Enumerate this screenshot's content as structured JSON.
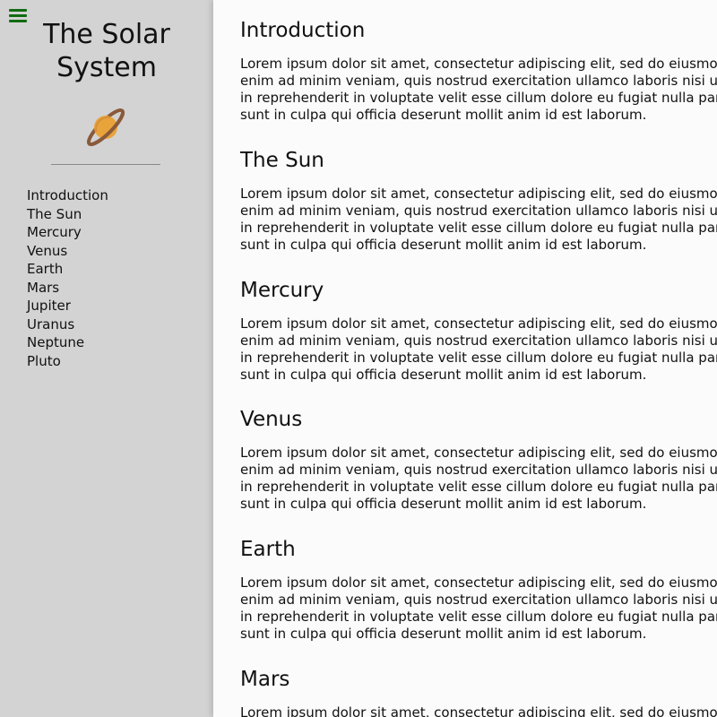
{
  "sidebar": {
    "title_line1": "The Solar",
    "title_line2": "System",
    "logo_icon": "planet-icon",
    "menu_icon": "hamburger-menu-icon",
    "nav_items": [
      "Introduction",
      "The Sun",
      "Mercury",
      "Venus",
      "Earth",
      "Mars",
      "Jupiter",
      "Uranus",
      "Neptune",
      "Pluto"
    ]
  },
  "colors": {
    "sidebar_bg": "#d3d3d3",
    "menu_icon": "#116b11",
    "planet_body": "#e8a33b",
    "planet_ring": "#8a5a3a"
  },
  "content": {
    "paragraph_lines": [
      "Lorem ipsum dolor sit amet, consectetur adipiscing elit, sed do eiusmod",
      "enim ad minim veniam, quis nostrud exercitation ullamco laboris nisi ut a",
      "in reprehenderit in voluptate velit esse cillum dolore eu fugiat nulla paria",
      "sunt in culpa qui officia deserunt mollit anim id est laborum."
    ],
    "sections": [
      {
        "heading": "Introduction"
      },
      {
        "heading": "The Sun"
      },
      {
        "heading": "Mercury"
      },
      {
        "heading": "Venus"
      },
      {
        "heading": "Earth"
      },
      {
        "heading": "Mars"
      }
    ]
  }
}
